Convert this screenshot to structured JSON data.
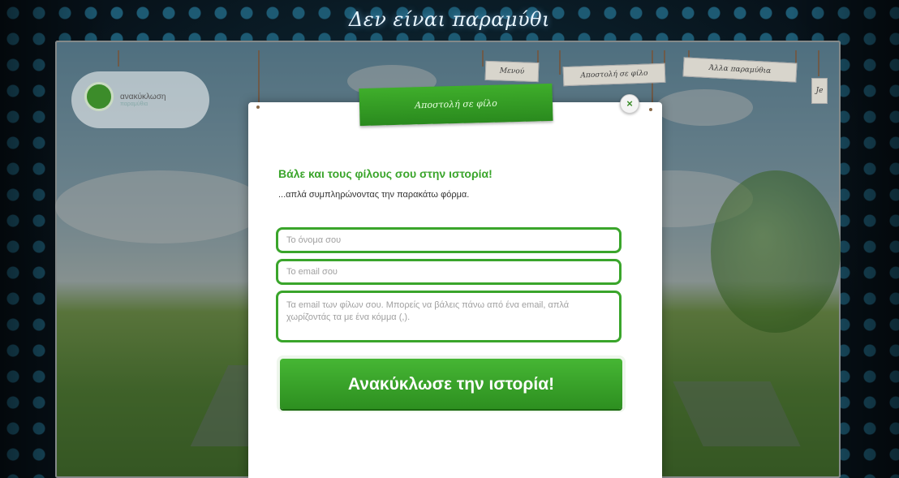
{
  "site": {
    "title": "Δεν είναι παραμύθι"
  },
  "logo": {
    "name": "ανακύκλωση",
    "tagline": "παραμύθια"
  },
  "nav": {
    "items": [
      {
        "label": "Μενού"
      },
      {
        "label": "Αποστολή σε φίλο"
      },
      {
        "label": "Άλλα παραμύθια"
      },
      {
        "label": "Je"
      }
    ]
  },
  "modal": {
    "ribbon_label": "Αποστολή σε φίλο",
    "close_symbol": "×",
    "heading": "Βάλε και τους φίλους σου στην ιστορία!",
    "subheading": "...απλά συμπληρώνοντας την παρακάτω φόρμα.",
    "name_placeholder": "Το όνομα σου",
    "email_placeholder": "Το email σου",
    "friends_placeholder": "Τα email των φίλων σου. Μπορείς να βάλεις πάνω από ένα email, απλά χωρίζοντάς τα με ένα κόμμα (,).",
    "submit_label": "Ανακύκλωσε την ιστορία!"
  },
  "colors": {
    "accent": "#3aa52b",
    "background": "#0b1a24"
  }
}
